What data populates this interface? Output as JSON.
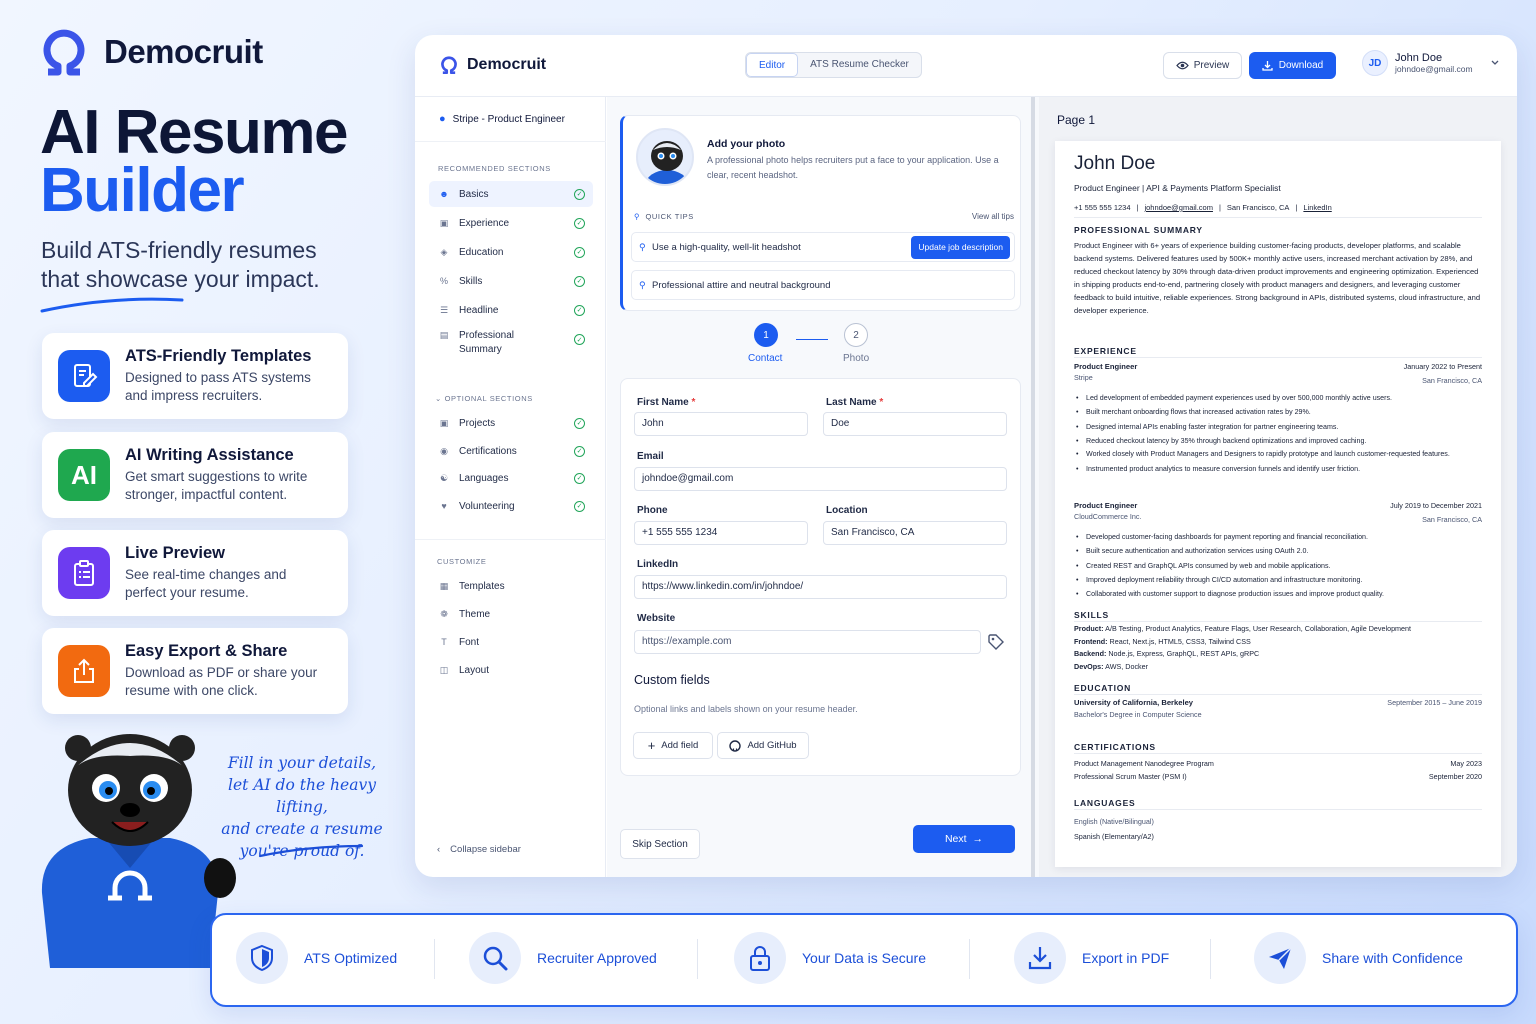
{
  "brand": {
    "name": "Democruit"
  },
  "hero": {
    "title_line1": "AI Resume",
    "title_line2": "Builder",
    "subtitle": "Build ATS-friendly resumes that showcase your impact."
  },
  "features": [
    {
      "title": "ATS-Friendly Templates",
      "desc": "Designed to pass ATS systems and impress recruiters.",
      "icon": "document-edit-icon",
      "color": "#1c5cf0"
    },
    {
      "title": "AI Writing Assistance",
      "desc": "Get smart suggestions to write stronger, impactful content.",
      "icon": "ai-icon",
      "color": "#1fa84f",
      "badge": "AI"
    },
    {
      "title": "Live Preview",
      "desc": "See real-time changes and perfect your resume.",
      "icon": "clipboard-icon",
      "color": "#6d3cf0"
    },
    {
      "title": "Easy Export & Share",
      "desc": "Download as PDF or share your resume with one click.",
      "icon": "share-upload-icon",
      "color": "#f26a10"
    }
  ],
  "mascot_note": [
    "Fill in your details,",
    "let AI do the heavy lifting,",
    "and create a resume",
    "you're proud of."
  ],
  "app": {
    "brand": "Democruit",
    "tabs": [
      "Editor",
      "ATS Resume Checker"
    ],
    "preview_label": "Preview",
    "download_label": "Download",
    "user": {
      "initials": "JD",
      "name": "John Doe",
      "email": "johndoe@gmail.com"
    }
  },
  "sidebar": {
    "job": "Stripe - Product Engineer",
    "recommended_heading": "RECOMMENDED SECTIONS",
    "recommended": [
      {
        "label": "Basics",
        "icon": "user-icon"
      },
      {
        "label": "Experience",
        "icon": "briefcase-icon"
      },
      {
        "label": "Education",
        "icon": "graduation-cap-icon"
      },
      {
        "label": "Skills",
        "icon": "percent-icon"
      },
      {
        "label": "Headline",
        "icon": "list-icon"
      },
      {
        "label": "Professional Summary",
        "icon": "document-icon"
      }
    ],
    "optional_heading": "OPTIONAL SECTIONS",
    "optional": [
      {
        "label": "Projects",
        "icon": "folder-icon"
      },
      {
        "label": "Certifications",
        "icon": "award-icon"
      },
      {
        "label": "Languages",
        "icon": "translate-icon"
      },
      {
        "label": "Volunteering",
        "icon": "heart-hand-icon"
      }
    ],
    "customize_heading": "CUSTOMIZE",
    "customize": [
      {
        "label": "Templates",
        "icon": "template-icon"
      },
      {
        "label": "Theme",
        "icon": "palette-icon"
      },
      {
        "label": "Font",
        "icon": "font-icon"
      },
      {
        "label": "Layout",
        "icon": "layout-icon"
      }
    ],
    "collapse": "Collapse sidebar"
  },
  "editor": {
    "photo_title": "Add your photo",
    "photo_desc": "A professional photo helps recruiters put a face to your application. Use a clear, recent headshot.",
    "quick_tips": "QUICK TIPS",
    "view_all": "View all tips",
    "tips": [
      "Use a high-quality, well-lit headshot",
      "Professional attire and neutral background"
    ],
    "update_job": "Update job description",
    "steps": [
      {
        "num": "1",
        "label": "Contact"
      },
      {
        "num": "2",
        "label": "Photo"
      }
    ],
    "fields": {
      "first_name": {
        "label": "First Name",
        "value": "John"
      },
      "last_name": {
        "label": "Last Name",
        "value": "Doe"
      },
      "email": {
        "label": "Email",
        "value": "johndoe@gmail.com"
      },
      "phone": {
        "label": "Phone",
        "value": "+1 555 555 1234"
      },
      "location": {
        "label": "Location",
        "value": "San Francisco, CA"
      },
      "linkedin": {
        "label": "LinkedIn",
        "value": "https://www.linkedin.com/in/johndoe/"
      },
      "website": {
        "label": "Website",
        "placeholder": "https://example.com"
      }
    },
    "custom_title": "Custom fields",
    "custom_desc": "Optional links and labels shown on your resume header.",
    "add_field": "Add field",
    "add_github": "Add GitHub",
    "skip": "Skip Section",
    "next": "Next"
  },
  "resume": {
    "page_label": "Page 1",
    "name": "John Doe",
    "role": "Product Engineer | API & Payments Platform Specialist",
    "contact": [
      "+1 555 555 1234",
      "johndoe@gmail.com",
      "San Francisco, CA",
      "LinkedIn"
    ],
    "summary_heading": "PROFESSIONAL SUMMARY",
    "summary": "Product Engineer with 6+ years of experience building customer-facing products, developer platforms, and scalable backend systems. Delivered features used by 500K+ monthly active users, increased merchant activation by 28%, and reduced checkout latency by 30% through data-driven product improvements and engineering optimization. Experienced in shipping products end-to-end, partnering closely with product managers and designers, and leveraging customer feedback to build intuitive, reliable experiences. Strong background in APIs, distributed systems, cloud infrastructure, and developer experience.",
    "experience_heading": "EXPERIENCE",
    "jobs": [
      {
        "title": "Product Engineer",
        "dates": "January 2022 to Present",
        "company": "Stripe",
        "location": "San Francisco, CA",
        "bullets": [
          "Led development of embedded payment experiences used by over 500,000 monthly active users.",
          "Built merchant onboarding flows that increased activation rates by 29%.",
          "Designed internal APIs enabling faster integration for partner engineering teams.",
          "Reduced checkout latency by 35% through backend optimizations and improved caching.",
          "Worked closely with Product Managers and Designers to rapidly prototype and launch customer-requested features.",
          "Instrumented product analytics to measure conversion funnels and identify user friction."
        ]
      },
      {
        "title": "Product Engineer",
        "dates": "July 2019 to December 2021",
        "company": "CloudCommerce Inc.",
        "location": "San Francisco, CA",
        "bullets": [
          "Developed customer-facing dashboards for payment reporting and financial reconciliation.",
          "Built secure authentication and authorization services using OAuth 2.0.",
          "Created REST and GraphQL APIs consumed by web and mobile applications.",
          "Improved deployment reliability through CI/CD automation and infrastructure monitoring.",
          "Collaborated with customer support to diagnose production issues and improve product quality."
        ]
      }
    ],
    "skills_heading": "SKILLS",
    "skills": [
      {
        "k": "Product:",
        "v": "A/B Testing, Product Analytics, Feature Flags, User Research, Collaboration, Agile Development"
      },
      {
        "k": "Frontend:",
        "v": "React, Next.js, HTML5, CSS3, Tailwind CSS"
      },
      {
        "k": "Backend:",
        "v": "Node.js, Express, GraphQL, REST APIs, gRPC"
      },
      {
        "k": "DevOps:",
        "v": "AWS, Docker"
      }
    ],
    "education_heading": "EDUCATION",
    "education": {
      "school": "University of California, Berkeley",
      "dates": "September 2015 – June 2019",
      "degree": "Bachelor's Degree in Computer Science"
    },
    "cert_heading": "CERTIFICATIONS",
    "certs": [
      {
        "name": "Product Management Nanodegree Program",
        "date": "May 2023"
      },
      {
        "name": "Professional Scrum Master (PSM I)",
        "date": "September 2020"
      }
    ],
    "lang_heading": "LANGUAGES",
    "languages": [
      "English (Native/Bilingual)",
      "Spanish (Elementary/A2)"
    ]
  },
  "bottom_bar": [
    {
      "label": "ATS Optimized",
      "icon": "shield-check-icon"
    },
    {
      "label": "Recruiter Approved",
      "icon": "search-icon"
    },
    {
      "label": "Your Data is Secure",
      "icon": "lock-icon"
    },
    {
      "label": "Export in PDF",
      "icon": "download-icon"
    },
    {
      "label": "Share with Confidence",
      "icon": "send-icon"
    }
  ]
}
